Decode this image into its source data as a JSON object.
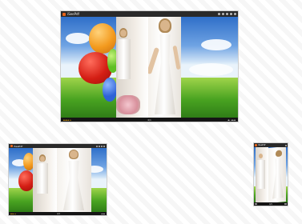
{
  "app": {
    "name": "iSeePdf",
    "accent_color": "#e8641b",
    "status_accent_color": "#e8a61b"
  },
  "views": {
    "desktop": {
      "top_label": "···",
      "page_indicator": "4/1",
      "left_status": "▸▸▸▸▸ ▸",
      "right_status": "◂▸ ◂◂◂◂"
    },
    "tablet": {
      "page_indicator": "4/1",
      "left_status": "▸▸▸▸ ▸",
      "right_status": "◂◂◂◂"
    },
    "phone": {
      "page_indicator": "4/1"
    }
  },
  "icons": [
    "logo-icon",
    "share-icon",
    "zoom-icon",
    "thumbnails-icon",
    "fullscreen-icon",
    "menu-icon"
  ]
}
